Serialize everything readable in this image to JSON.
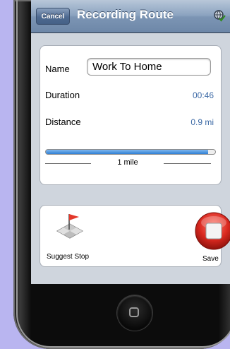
{
  "navbar": {
    "cancel_label": "Cancel",
    "title": "Recording Route",
    "action_icon": "globe-check-icon"
  },
  "info": {
    "name_label": "Name",
    "name_value": "Work To Home",
    "duration_label": "Duration",
    "duration_value": "00:46",
    "distance_label": "Distance",
    "distance_value": "0.9 mi",
    "progress_fraction": 0.96,
    "scale_label": "1 mile"
  },
  "actions": {
    "suggest_stop_label": "Suggest Stop",
    "suggest_stop_icon": "map-flag-icon",
    "save_label": "Save",
    "save_icon": "stop-record-icon"
  },
  "colors": {
    "value_text": "#3d6aa6",
    "progress": "#2f7fd4",
    "save_button": "#d9281f"
  }
}
